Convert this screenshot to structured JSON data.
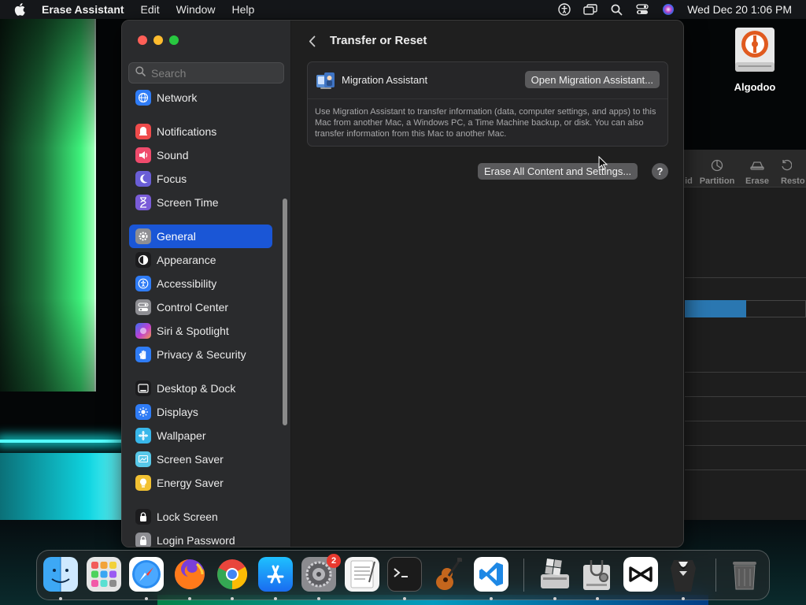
{
  "menubar": {
    "app_name": "Erase Assistant",
    "items": [
      "Edit",
      "Window",
      "Help"
    ],
    "clock": "Wed Dec 20  1:06 PM",
    "status_icons": [
      "accessibility-icon",
      "screen-mirror-icon",
      "spotlight-icon",
      "control-center-icon",
      "siri-icon"
    ]
  },
  "desktop": {
    "icon_label": "Algodoo"
  },
  "background_app": {
    "toolbar": [
      "id",
      "Partition",
      "Erase",
      "Resto"
    ]
  },
  "sidebar": {
    "search_placeholder": "Search",
    "items": [
      {
        "label": "Network",
        "icon": "network-icon",
        "color": "#2f7cf6"
      },
      {
        "label": "Notifications",
        "icon": "notifications-icon",
        "color": "#ef4b4b"
      },
      {
        "label": "Sound",
        "icon": "sound-icon",
        "color": "#ef4b6c"
      },
      {
        "label": "Focus",
        "icon": "focus-icon",
        "color": "#6a5ed6"
      },
      {
        "label": "Screen Time",
        "icon": "screen-time-icon",
        "color": "#7a5cd8"
      },
      {
        "label": "General",
        "icon": "general-icon",
        "color": "#8e8e93"
      },
      {
        "label": "Appearance",
        "icon": "appearance-icon",
        "color": "#1c1c1e"
      },
      {
        "label": "Accessibility",
        "icon": "accessibility-icon",
        "color": "#2f7cf6"
      },
      {
        "label": "Control Center",
        "icon": "control-center-icon",
        "color": "#8e8e93"
      },
      {
        "label": "Siri & Spotlight",
        "icon": "siri-icon",
        "color": "#c240d0"
      },
      {
        "label": "Privacy & Security",
        "icon": "privacy-icon",
        "color": "#2f7cf6"
      },
      {
        "label": "Desktop & Dock",
        "icon": "desktop-dock-icon",
        "color": "#1c1c1e"
      },
      {
        "label": "Displays",
        "icon": "displays-icon",
        "color": "#2f7cf6"
      },
      {
        "label": "Wallpaper",
        "icon": "wallpaper-icon",
        "color": "#38b7ea"
      },
      {
        "label": "Screen Saver",
        "icon": "screen-saver-icon",
        "color": "#58c8e8"
      },
      {
        "label": "Energy Saver",
        "icon": "energy-saver-icon",
        "color": "#f2c132"
      },
      {
        "label": "Lock Screen",
        "icon": "lock-screen-icon",
        "color": "#1c1c1e"
      },
      {
        "label": "Login Password",
        "icon": "login-password-icon",
        "color": "#8e8e93"
      }
    ],
    "active": "General"
  },
  "content": {
    "title": "Transfer or Reset",
    "migration": {
      "label": "Migration Assistant",
      "button": "Open Migration Assistant...",
      "description": "Use Migration Assistant to transfer information (data, computer settings, and apps) to this Mac from another Mac, a Windows PC, a Time Machine backup, or disk. You can also transfer information from this Mac to another Mac."
    },
    "erase_button": "Erase All Content and Settings...",
    "help_button": "?"
  },
  "dock": {
    "apps": [
      "Finder",
      "Launchpad",
      "Safari",
      "Firefox",
      "Chrome",
      "App Store",
      "System Settings",
      "TextEdit",
      "Terminal",
      "GarageBand",
      "Visual Studio Code",
      "Boot Camp Assistant",
      "Disk Utility",
      "CapCut",
      "Alfred",
      "Trash"
    ],
    "settings_badge": "2"
  },
  "colors": {
    "accent": "#1a56d6",
    "window_bg": "#1f1f1f",
    "sidebar_bg": "#2a2b2d",
    "button_bg": "#5a5a5c"
  }
}
